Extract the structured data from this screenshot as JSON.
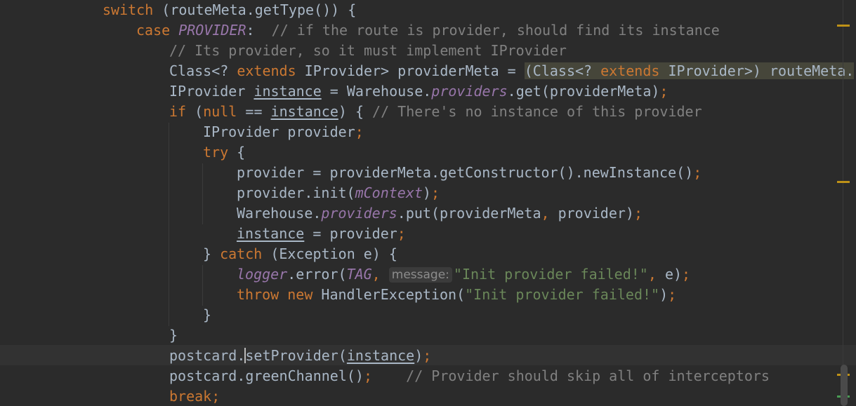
{
  "editor": {
    "lines": [
      [
        {
          "t": "switch",
          "c": "kw"
        },
        {
          "t": " (routeMeta.getType()) {",
          "c": "plain"
        }
      ],
      [
        {
          "t": "case ",
          "c": "kw"
        },
        {
          "t": "PROVIDER",
          "c": "static"
        },
        {
          "t": ":  ",
          "c": "plain"
        },
        {
          "t": "// if the route is provider, should find its instance",
          "c": "comment"
        }
      ],
      [
        {
          "t": "// Its provider, so it must implement IProvider",
          "c": "comment"
        }
      ],
      [
        {
          "t": "Class<? ",
          "c": "plain"
        },
        {
          "t": "extends",
          "c": "kw"
        },
        {
          "t": " IProvider> providerMeta = ",
          "c": "plain"
        },
        {
          "t": "(Class<? ",
          "c": "cast"
        },
        {
          "t": "extends",
          "c": "cast-kw"
        },
        {
          "t": " IProvider>) routeMeta.",
          "c": "cast"
        }
      ],
      [
        {
          "t": "IProvider ",
          "c": "plain"
        },
        {
          "t": "instance",
          "c": "ul"
        },
        {
          "t": " = Warehouse.",
          "c": "plain"
        },
        {
          "t": "providers",
          "c": "field"
        },
        {
          "t": ".get(providerMeta)",
          "c": "plain"
        },
        {
          "t": ";",
          "c": "punct"
        }
      ],
      [
        {
          "t": "if",
          "c": "kw"
        },
        {
          "t": " (",
          "c": "plain"
        },
        {
          "t": "null",
          "c": "kw"
        },
        {
          "t": " == ",
          "c": "plain"
        },
        {
          "t": "instance",
          "c": "ul"
        },
        {
          "t": ") { ",
          "c": "plain"
        },
        {
          "t": "// There's no instance of this provider",
          "c": "comment"
        }
      ],
      [
        {
          "t": "IProvider provider",
          "c": "plain"
        },
        {
          "t": ";",
          "c": "punct"
        }
      ],
      [
        {
          "t": "try",
          "c": "kw"
        },
        {
          "t": " {",
          "c": "plain"
        }
      ],
      [
        {
          "t": "provider = providerMeta.getConstructor().newInstance()",
          "c": "plain"
        },
        {
          "t": ";",
          "c": "punct"
        }
      ],
      [
        {
          "t": "provider.init(",
          "c": "plain"
        },
        {
          "t": "mContext",
          "c": "field"
        },
        {
          "t": ")",
          "c": "plain"
        },
        {
          "t": ";",
          "c": "punct"
        }
      ],
      [
        {
          "t": "Warehouse.",
          "c": "plain"
        },
        {
          "t": "providers",
          "c": "field"
        },
        {
          "t": ".put(providerMeta",
          "c": "plain"
        },
        {
          "t": ",",
          "c": "punct"
        },
        {
          "t": " provider)",
          "c": "plain"
        },
        {
          "t": ";",
          "c": "punct"
        }
      ],
      [
        {
          "t": "instance",
          "c": "ul"
        },
        {
          "t": " = provider",
          "c": "plain"
        },
        {
          "t": ";",
          "c": "punct"
        }
      ],
      [
        {
          "t": "} ",
          "c": "plain"
        },
        {
          "t": "catch",
          "c": "kw"
        },
        {
          "t": " (Exception e) {",
          "c": "plain"
        }
      ],
      [
        {
          "t": "logger",
          "c": "field"
        },
        {
          "t": ".error(",
          "c": "plain"
        },
        {
          "t": "TAG",
          "c": "static"
        },
        {
          "t": ",",
          "c": "punct"
        },
        {
          "t": " ",
          "c": "plain"
        },
        {
          "t": "message:",
          "c": "hint"
        },
        {
          "t": "\"Init provider failed!\"",
          "c": "string"
        },
        {
          "t": ",",
          "c": "punct"
        },
        {
          "t": " e)",
          "c": "plain"
        },
        {
          "t": ";",
          "c": "punct"
        }
      ],
      [
        {
          "t": "throw new",
          "c": "kw"
        },
        {
          "t": " HandlerException(",
          "c": "plain"
        },
        {
          "t": "\"Init provider failed!\"",
          "c": "string"
        },
        {
          "t": ")",
          "c": "plain"
        },
        {
          "t": ";",
          "c": "punct"
        }
      ],
      [
        {
          "t": "}",
          "c": "plain"
        }
      ],
      [
        {
          "t": "}",
          "c": "plain"
        }
      ],
      [
        {
          "t": "postcard.",
          "c": "plain"
        },
        {
          "t": "",
          "c": "caret"
        },
        {
          "t": "setProvider(",
          "c": "plain"
        },
        {
          "t": "instance",
          "c": "ul"
        },
        {
          "t": ")",
          "c": "plain"
        },
        {
          "t": ";",
          "c": "punct"
        }
      ],
      [
        {
          "t": "postcard.greenChannel()",
          "c": "plain"
        },
        {
          "t": ";",
          "c": "punct"
        },
        {
          "t": "    ",
          "c": "plain"
        },
        {
          "t": "// Provider should skip all of interceptors",
          "c": "comment"
        }
      ],
      [
        {
          "t": "break",
          "c": "kw"
        },
        {
          "t": ";",
          "c": "punct"
        }
      ]
    ]
  },
  "colors": {
    "background": "#2b2b2b",
    "keyword": "#cc7832",
    "comment": "#808080",
    "field": "#9876aa",
    "string": "#6a8759",
    "text": "#a9b7c6",
    "warning_marker": "#be9117",
    "ok_marker": "#499c54"
  }
}
